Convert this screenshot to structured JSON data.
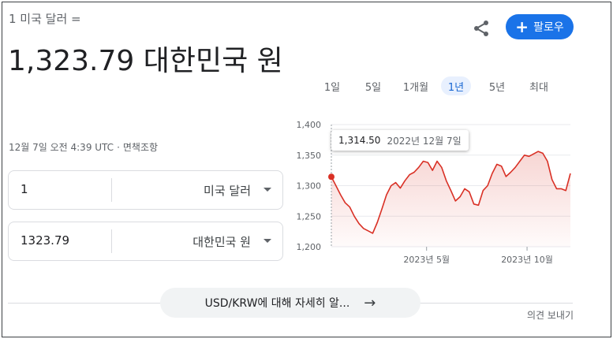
{
  "header": {
    "subtitle": "1 미국 달러 =",
    "rate_value": "1,323.79 대한민국 원",
    "timestamp": "12월 7일 오전 4:39 UTC",
    "separator": "·",
    "disclaimer": "면책조항"
  },
  "actions": {
    "share_icon": "share-icon",
    "follow_icon": "plus-icon",
    "follow_label": "팔로우",
    "accent_color": "#1a73e8"
  },
  "converter": {
    "from": {
      "value": "1",
      "currency": "미국 달러"
    },
    "to": {
      "value": "1323.79",
      "currency": "대한민국 원"
    }
  },
  "ranges": {
    "items": [
      "1일",
      "5일",
      "1개월",
      "1년",
      "5년",
      "최대"
    ],
    "active": "1년"
  },
  "tooltip": {
    "value": "1,314.50",
    "date": "2022년 12월 7일"
  },
  "chart_data": {
    "type": "area",
    "color": "#d93025",
    "grid": true,
    "ylim": [
      1200,
      1400
    ],
    "y_ticks": [
      "1,400",
      "1,350",
      "1,300",
      "1,250",
      "1,200"
    ],
    "x_ticks": [
      "2023년 5월",
      "2023년 10월"
    ],
    "series": [
      {
        "x": [
          "2022-12-07",
          "2022-12-14",
          "2022-12-21",
          "2022-12-28",
          "2023-01-04",
          "2023-01-11",
          "2023-01-18",
          "2023-01-25",
          "2023-02-01",
          "2023-02-08",
          "2023-02-15",
          "2023-02-22",
          "2023-03-01",
          "2023-03-08",
          "2023-03-15",
          "2023-03-22",
          "2023-03-29",
          "2023-04-05",
          "2023-04-12",
          "2023-04-19",
          "2023-04-26",
          "2023-05-03",
          "2023-05-10",
          "2023-05-17",
          "2023-05-24",
          "2023-05-31",
          "2023-06-07",
          "2023-06-14",
          "2023-06-21",
          "2023-06-28",
          "2023-07-05",
          "2023-07-12",
          "2023-07-19",
          "2023-07-26",
          "2023-08-02",
          "2023-08-09",
          "2023-08-16",
          "2023-08-23",
          "2023-08-30",
          "2023-09-06",
          "2023-09-13",
          "2023-09-20",
          "2023-09-27",
          "2023-10-04",
          "2023-10-11",
          "2023-10-18",
          "2023-10-25",
          "2023-11-01",
          "2023-11-08",
          "2023-11-15",
          "2023-11-22",
          "2023-11-29",
          "2023-12-06"
        ],
        "values": [
          1314.5,
          1300,
          1285,
          1272,
          1265,
          1250,
          1238,
          1230,
          1226,
          1222,
          1240,
          1262,
          1285,
          1300,
          1305,
          1296,
          1308,
          1318,
          1322,
          1330,
          1340,
          1338,
          1325,
          1340,
          1330,
          1308,
          1292,
          1275,
          1282,
          1295,
          1290,
          1270,
          1268,
          1292,
          1300,
          1320,
          1335,
          1332,
          1315,
          1322,
          1330,
          1340,
          1350,
          1348,
          1352,
          1356,
          1353,
          1340,
          1310,
          1295,
          1295,
          1292,
          1320
        ]
      }
    ]
  },
  "footer": {
    "more_label": "USD/KRW에 대해 자세히 알...",
    "arrow_icon": "arrow-right-icon",
    "feedback_label": "의견 보내기"
  }
}
